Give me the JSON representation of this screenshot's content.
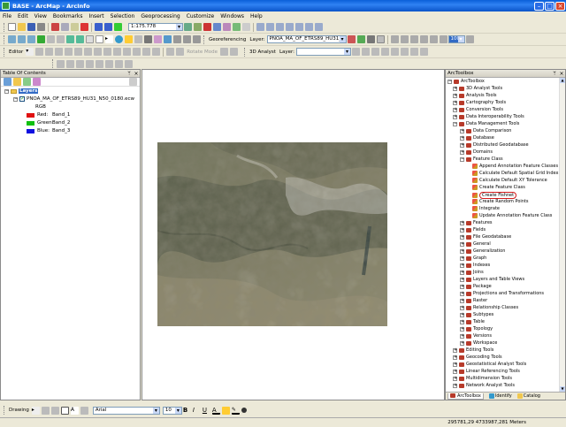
{
  "window": {
    "title": "BASE - ArcMap - ArcInfo"
  },
  "menu": [
    "File",
    "Edit",
    "View",
    "Bookmarks",
    "Insert",
    "Selection",
    "Geoprocessing",
    "Customize",
    "Windows",
    "Help"
  ],
  "toolbar": {
    "scale": "1:175.778",
    "georeferencing_label": "Georeferencing",
    "layer_label": "Layer:",
    "layer_value": "PNOA_MA_OF_ETRS89_HU31_N5",
    "zoom_value": "100%",
    "editor_label": "Editor",
    "rotate_mode_label": "Rotate Mode",
    "analyst_label": "3D Analyst",
    "analyst_layer_label": "Layer:"
  },
  "toc": {
    "title": "Table Of Contents",
    "root": "Layers",
    "layer_name": "PNOA_MA_OF_ETRS89_HU31_N50_0180.ecw",
    "rgb_label": "RGB",
    "bands": [
      {
        "channel": "Red:",
        "band": "Band_1",
        "color": "#e01010"
      },
      {
        "channel": "Green:",
        "band": "Band_2",
        "color": "#10c010"
      },
      {
        "channel": "Blue:",
        "band": "Band_3",
        "color": "#1010e0"
      }
    ]
  },
  "arctoolbox": {
    "title": "ArcToolbox",
    "root": "ArcToolbox",
    "toolboxes_top": [
      "3D Analyst Tools",
      "Analysis Tools",
      "Cartography Tools",
      "Conversion Tools",
      "Data Interoperability Tools",
      "Data Management Tools"
    ],
    "dm_sets_before": [
      "Data Comparison",
      "Database",
      "Distributed Geodatabase",
      "Domains",
      "Feature Class"
    ],
    "feature_class_tools": [
      "Append Annotation Feature Classes",
      "Calculate Default Spatial Grid Index",
      "Calculate Default XY Tolerance",
      "Create Feature Class",
      "Create Fishnet",
      "Create Random Points",
      "Integrate",
      "Update Annotation Feature Class"
    ],
    "selected_tool": "Create Fishnet",
    "dm_sets_after": [
      "Features",
      "Fields",
      "File Geodatabase",
      "General",
      "Generalization",
      "Graph",
      "Indexes",
      "Joins",
      "Layers and Table Views",
      "Package",
      "Projections and Transformations",
      "Raster",
      "Relationship Classes",
      "Subtypes",
      "Table",
      "Topology",
      "Versions",
      "Workspace"
    ],
    "toolboxes_bottom": [
      "Editing Tools",
      "Geocoding Tools",
      "Geostatistical Analyst Tools",
      "Linear Referencing Tools",
      "Multidimension Tools",
      "Network Analyst Tools"
    ],
    "tabs": [
      "ArcToolbox",
      "Identify",
      "Catalog"
    ]
  },
  "drawing": {
    "label": "Drawing",
    "font": "Arial",
    "size": "10"
  },
  "status": {
    "coords": "295781,29  4733987,281 Meters"
  }
}
